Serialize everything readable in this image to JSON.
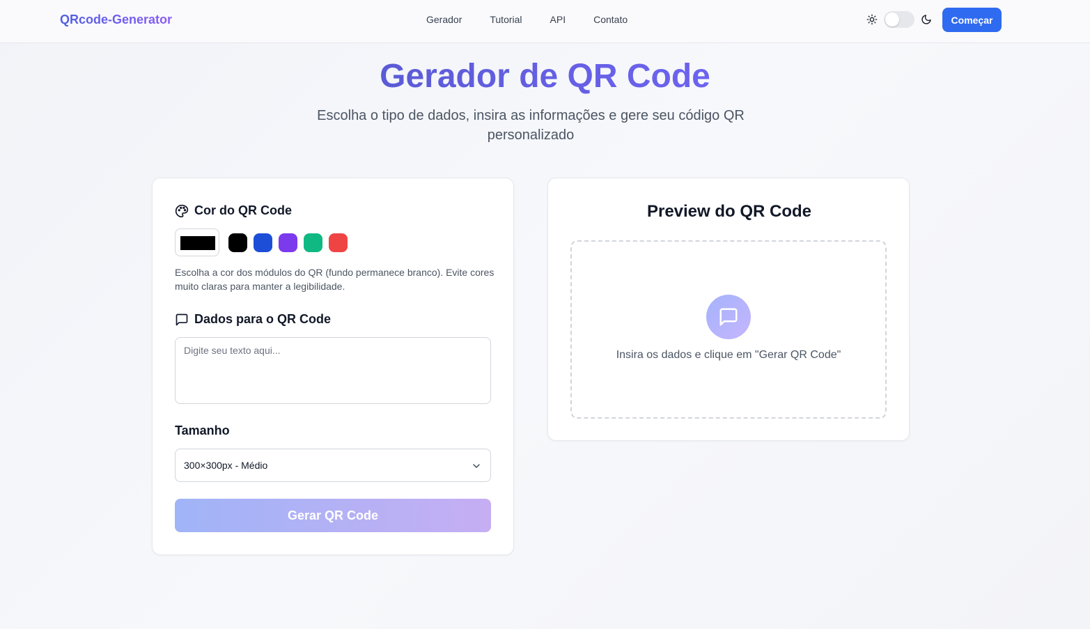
{
  "nav": {
    "brand": "QRcode-Generator",
    "links": [
      "Gerador",
      "Tutorial",
      "API",
      "Contato"
    ],
    "cta_label": "Começar"
  },
  "hero": {
    "title": "Gerador de QR Code",
    "subtitle": "Escolha o tipo de dados, insira as informações e gere seu código QR personalizado"
  },
  "form": {
    "color_section_title": "Cor do QR Code",
    "selected_color": "#000000",
    "presets": [
      "#000000",
      "#1d4ed8",
      "#7c3aed",
      "#10b981",
      "#ef4444"
    ],
    "color_hint": "Escolha a cor dos módulos do QR (fundo permanece branco). Evite cores muito claras para manter a legibilidade.",
    "data_section_title": "Dados para o QR Code",
    "data_placeholder": "Digite seu texto aqui...",
    "data_value": "",
    "size_label": "Tamanho",
    "size_value": "300×300px - Médio",
    "generate_label": "Gerar QR Code"
  },
  "preview": {
    "title": "Preview do QR Code",
    "empty_text": "Insira os dados e clique em \"Gerar QR Code\""
  },
  "colors": {
    "accent": "#2f6bf0",
    "brand_gradient_start": "#4f5fe0",
    "brand_gradient_end": "#8b5cf6"
  },
  "icons": {
    "theme_light": "sun-icon",
    "theme_dark": "moon-icon",
    "palette": "palette-icon",
    "message": "message-square-icon",
    "chevron": "chevron-down-icon"
  }
}
